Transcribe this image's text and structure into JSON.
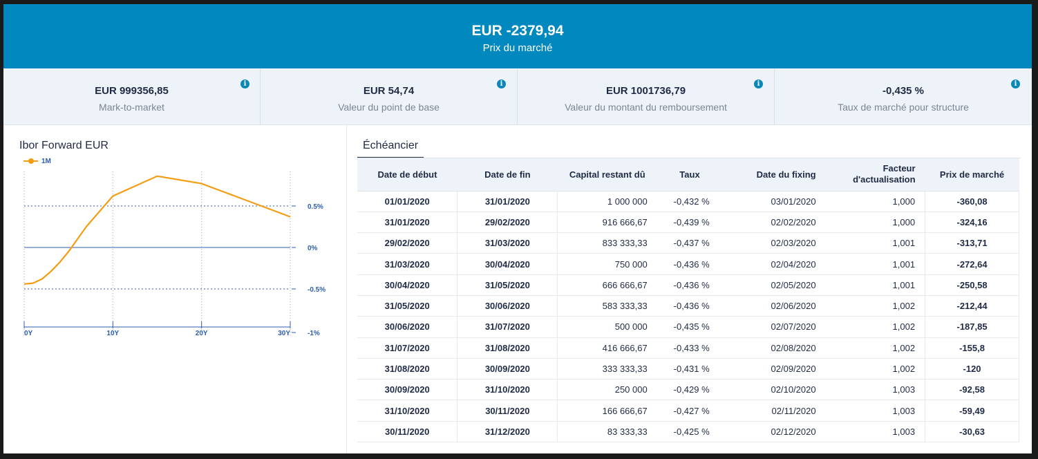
{
  "header": {
    "amount": "EUR -2379,94",
    "label": "Prix du marché"
  },
  "metrics": [
    {
      "value": "EUR 999356,85",
      "label": "Mark-to-market",
      "icon": "info-icon"
    },
    {
      "value": "EUR 54,74",
      "label": "Valeur du point de base",
      "icon": "info-icon"
    },
    {
      "value": "EUR 1001736,79",
      "label": "Valeur du montant du remboursement",
      "icon": "info-icon"
    },
    {
      "value": "-0,435 %",
      "label": "Taux de marché pour structure",
      "icon": "info-icon"
    }
  ],
  "chart_data": {
    "type": "line",
    "title": "Ibor Forward EUR",
    "series": [
      {
        "name": "1M",
        "color": "#f39c12",
        "x": [
          0,
          1,
          2,
          3,
          4,
          5,
          7,
          10,
          15,
          20,
          30
        ],
        "y": [
          -0.44,
          -0.43,
          -0.38,
          -0.29,
          -0.18,
          -0.05,
          0.25,
          0.62,
          0.86,
          0.77,
          0.37
        ]
      }
    ],
    "x_ticks": [
      "0Y",
      "10Y",
      "20Y",
      "30Y"
    ],
    "x_tick_values": [
      0,
      10,
      20,
      30
    ],
    "y_ticks": [
      "0.5%",
      "0%",
      "-0.5%",
      "-1%"
    ],
    "y_tick_values": [
      0.5,
      0,
      -0.5,
      -1
    ],
    "xlim": [
      0,
      30
    ],
    "ylim": [
      -1,
      1
    ],
    "legend": "top-left"
  },
  "schedule": {
    "tab": "Échéancier",
    "columns": [
      "Date de début",
      "Date de fin",
      "Capital restant dû",
      "Taux",
      "Date du fixing",
      "Facteur d'actualisation",
      "Prix de marché"
    ],
    "rows": [
      [
        "01/01/2020",
        "31/01/2020",
        "1 000 000",
        "-0,432 %",
        "03/01/2020",
        "1,000",
        "-360,08"
      ],
      [
        "31/01/2020",
        "29/02/2020",
        "916 666,67",
        "-0,439 %",
        "02/02/2020",
        "1,000",
        "-324,16"
      ],
      [
        "29/02/2020",
        "31/03/2020",
        "833 333,33",
        "-0,437 %",
        "02/03/2020",
        "1,001",
        "-313,71"
      ],
      [
        "31/03/2020",
        "30/04/2020",
        "750 000",
        "-0,436 %",
        "02/04/2020",
        "1,001",
        "-272,64"
      ],
      [
        "30/04/2020",
        "31/05/2020",
        "666 666,67",
        "-0,436 %",
        "02/05/2020",
        "1,001",
        "-250,58"
      ],
      [
        "31/05/2020",
        "30/06/2020",
        "583 333,33",
        "-0,436 %",
        "02/06/2020",
        "1,002",
        "-212,44"
      ],
      [
        "30/06/2020",
        "31/07/2020",
        "500 000",
        "-0,435 %",
        "02/07/2020",
        "1,002",
        "-187,85"
      ],
      [
        "31/07/2020",
        "31/08/2020",
        "416 666,67",
        "-0,433 %",
        "02/08/2020",
        "1,002",
        "-155,8"
      ],
      [
        "31/08/2020",
        "30/09/2020",
        "333 333,33",
        "-0,431 %",
        "02/09/2020",
        "1,002",
        "-120"
      ],
      [
        "30/09/2020",
        "31/10/2020",
        "250 000",
        "-0,429 %",
        "02/10/2020",
        "1,003",
        "-92,58"
      ],
      [
        "31/10/2020",
        "30/11/2020",
        "166 666,67",
        "-0,427 %",
        "02/11/2020",
        "1,003",
        "-59,49"
      ],
      [
        "30/11/2020",
        "31/12/2020",
        "83 333,33",
        "-0,425 %",
        "02/12/2020",
        "1,003",
        "-30,63"
      ]
    ]
  }
}
